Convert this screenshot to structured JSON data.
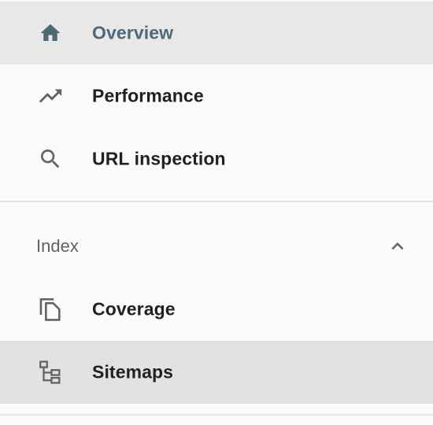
{
  "nav": {
    "items": [
      {
        "label": "Overview",
        "icon": "home-icon",
        "selected": true
      },
      {
        "label": "Performance",
        "icon": "trending-up-icon",
        "selected": false
      },
      {
        "label": "URL inspection",
        "icon": "search-icon",
        "selected": false
      }
    ],
    "index_section": {
      "label": "Index",
      "expanded": true,
      "chevron_icon": "chevron-up-icon",
      "items": [
        {
          "label": "Coverage",
          "icon": "file-copy-icon",
          "selected": false
        },
        {
          "label": "Sitemaps",
          "icon": "sitemap-icon",
          "selected": true
        }
      ]
    }
  },
  "colors": {
    "accent_text": "#4f6877",
    "accent_icon": "#4f6877",
    "selected_bg": "#e8e8e8",
    "icon_gray": "#5f6368",
    "text_primary": "#202124"
  }
}
